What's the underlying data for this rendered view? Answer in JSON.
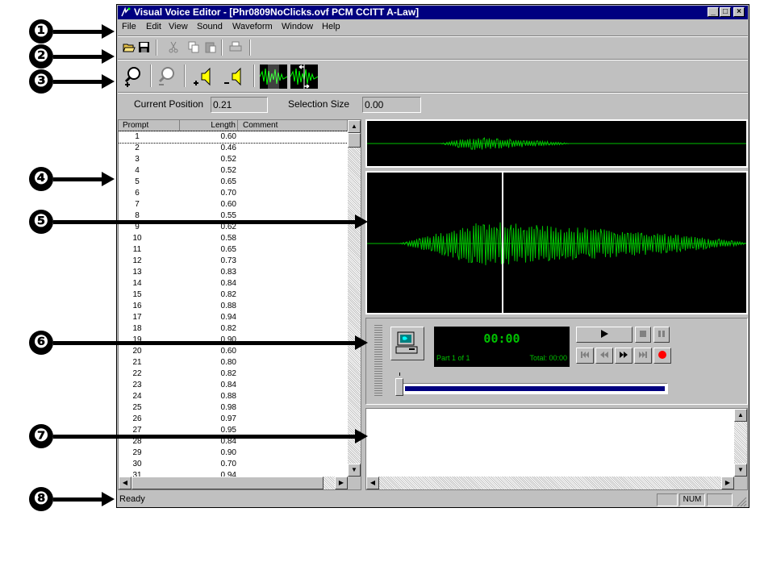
{
  "window": {
    "title": "Visual Voice Editor - [Phr0809NoClicks.ovf PCM CCITT A-Law]",
    "minimize": "_",
    "restore": "□",
    "close": "×"
  },
  "menu": [
    "File",
    "Edit",
    "View",
    "Sound",
    "Waveform",
    "Window",
    "Help"
  ],
  "toolbar": {
    "icons": [
      "open-icon",
      "save-icon",
      "cut-icon",
      "copy-icon",
      "paste-icon",
      "print-icon"
    ]
  },
  "wave_toolbar": {
    "icons": [
      "zoom-in-icon",
      "zoom-out-icon",
      "volume-up-icon",
      "volume-down-icon",
      "select-waveform-icon",
      "expand-selection-icon"
    ]
  },
  "fields": {
    "current_position_label": "Current Position",
    "current_position_value": "0.21",
    "selection_size_label": "Selection Size",
    "selection_size_value": "0.00"
  },
  "prompt_list": {
    "headers": [
      "Prompt",
      "Length",
      "Comment"
    ],
    "rows": [
      [
        "1",
        "0.60"
      ],
      [
        "2",
        "0.46"
      ],
      [
        "3",
        "0.52"
      ],
      [
        "4",
        "0.52"
      ],
      [
        "5",
        "0.65"
      ],
      [
        "6",
        "0.70"
      ],
      [
        "7",
        "0.60"
      ],
      [
        "8",
        "0.55"
      ],
      [
        "9",
        "0.62"
      ],
      [
        "10",
        "0.58"
      ],
      [
        "11",
        "0.65"
      ],
      [
        "12",
        "0.73"
      ],
      [
        "13",
        "0.83"
      ],
      [
        "14",
        "0.84"
      ],
      [
        "15",
        "0.82"
      ],
      [
        "16",
        "0.88"
      ],
      [
        "17",
        "0.94"
      ],
      [
        "18",
        "0.82"
      ],
      [
        "19",
        "0.90"
      ],
      [
        "20",
        "0.60"
      ],
      [
        "21",
        "0.80"
      ],
      [
        "22",
        "0.82"
      ],
      [
        "23",
        "0.84"
      ],
      [
        "24",
        "0.88"
      ],
      [
        "25",
        "0.98"
      ],
      [
        "26",
        "0.97"
      ],
      [
        "27",
        "0.95"
      ],
      [
        "28",
        "0.84"
      ],
      [
        "29",
        "0.90"
      ],
      [
        "30",
        "0.70"
      ],
      [
        "31",
        "0.94"
      ]
    ]
  },
  "player": {
    "time": "00:00",
    "part": "Part 1 of 1",
    "total": "Total: 00:00",
    "progress": 0,
    "lcd_color": "#00c000"
  },
  "statusbar": {
    "text": "Ready",
    "num": "NUM"
  },
  "callouts": [
    "❶",
    "❷",
    "❸",
    "❹",
    "❺",
    "❻",
    "❼",
    "❽"
  ],
  "colors": {
    "title_bar": "#000080",
    "waveform": "#00c000",
    "cursor": "#ffffff",
    "record": "#ff0000",
    "seek_bar": "#000080"
  }
}
